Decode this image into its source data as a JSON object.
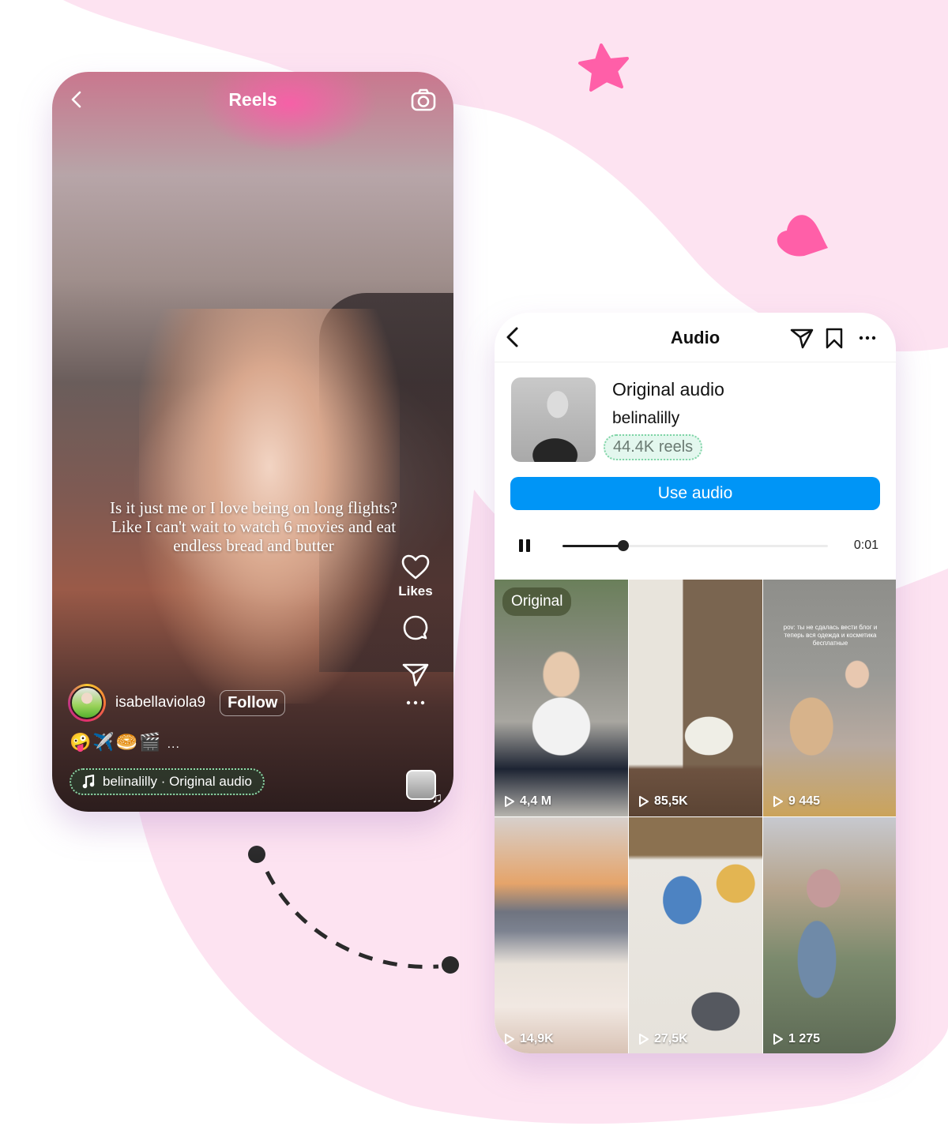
{
  "colors": {
    "background_blob": "#fde3f1",
    "accent_pink": "#ff5fa8",
    "instagram_blue": "#0095f6",
    "reels_chip_border": "#8fd9a8"
  },
  "reels_screen": {
    "header": {
      "back_icon": "chevron-left-icon",
      "title": "Reels",
      "camera_icon": "camera-icon"
    },
    "caption": "Is it just me or I love being on long flights? Like I can't wait to watch 6 movies and eat endless bread and butter",
    "side_actions": [
      {
        "icon": "heart-icon",
        "label": "Likes"
      },
      {
        "icon": "comment-icon",
        "label": ""
      },
      {
        "icon": "send-icon",
        "label": ""
      },
      {
        "icon": "more-icon",
        "label": ""
      }
    ],
    "author": {
      "username": "isabellaviola9",
      "follow_label": "Follow"
    },
    "emojis": "🤪✈️🥯🎬",
    "emoji_more": "...",
    "audio_chip": {
      "icon": "music-note-icon",
      "text": "belinalilly · Original audio"
    }
  },
  "audio_screen": {
    "header": {
      "back_icon": "chevron-left-icon",
      "title": "Audio",
      "share_icon": "send-icon",
      "save_icon": "bookmark-icon",
      "more_icon": "more-horizontal-icon"
    },
    "track": {
      "title": "Original audio",
      "artist": "belinalilly",
      "reels_count": "44.4K reels"
    },
    "use_audio_label": "Use audio",
    "player": {
      "state": "playing",
      "progress": 0.23,
      "time": "0:01"
    },
    "grid": [
      {
        "views": "4,4 M",
        "badge": "Original"
      },
      {
        "views": "85,5K",
        "badge": ""
      },
      {
        "views": "9 445",
        "badge": "",
        "caption": "pov: ты не сдалась вести блог и теперь вся одежда и косметика бесплатные"
      },
      {
        "views": "14,9K",
        "badge": ""
      },
      {
        "views": "27,5K",
        "badge": ""
      },
      {
        "views": "1 275",
        "badge": ""
      }
    ]
  }
}
